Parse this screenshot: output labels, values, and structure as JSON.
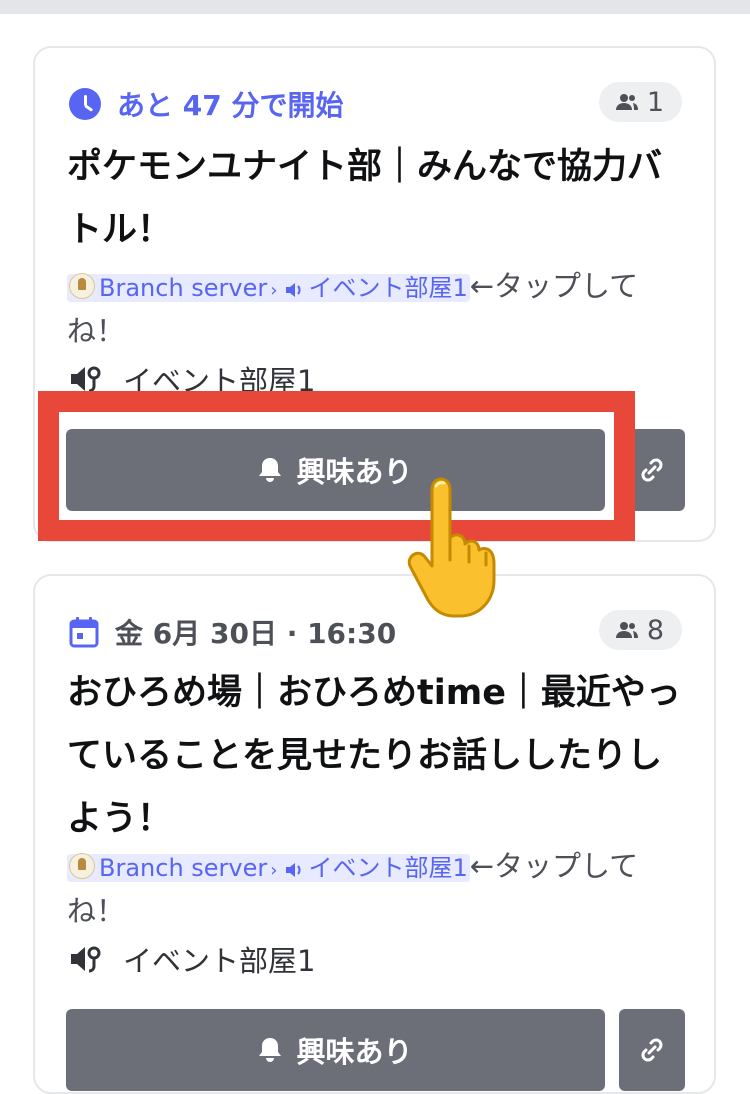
{
  "events": [
    {
      "time_text": "あと 47 分で開始",
      "time_style": "accent",
      "interested_count": "1",
      "title": "ポケモンユナイト部｜みんなで協力バトル！",
      "mention": {
        "server_name": "Branch server",
        "separator": "›",
        "channel_name": "イベント部屋1"
      },
      "channel_suffix": "←タップしてね！",
      "location": "イベント部屋1",
      "interest_button_label": "興味あり"
    },
    {
      "time_text": "金 6月 30日 · 16:30",
      "time_style": "muted",
      "interested_count": "8",
      "title": "おひろめ場｜おひろめtime｜最近やっていることを見せたりお話ししたりしよう！",
      "mention": {
        "server_name": "Branch server",
        "separator": "›",
        "channel_name": "イベント部屋1"
      },
      "channel_suffix": "←タップしてね！",
      "location": "イベント部屋1",
      "interest_button_label": "興味あり"
    }
  ],
  "icons": {
    "clock": "clock-icon",
    "calendar": "calendar-icon",
    "people": "people-icon",
    "speaker": "speaker-icon",
    "stage": "stage-channel-icon",
    "bell": "bell-icon",
    "link": "link-icon",
    "pointer": "pointing-hand-icon"
  },
  "colors": {
    "accent": "#5865f2",
    "button": "#6d6f78",
    "highlight": "#e8483a",
    "mention_bg": "#e8eaff"
  }
}
